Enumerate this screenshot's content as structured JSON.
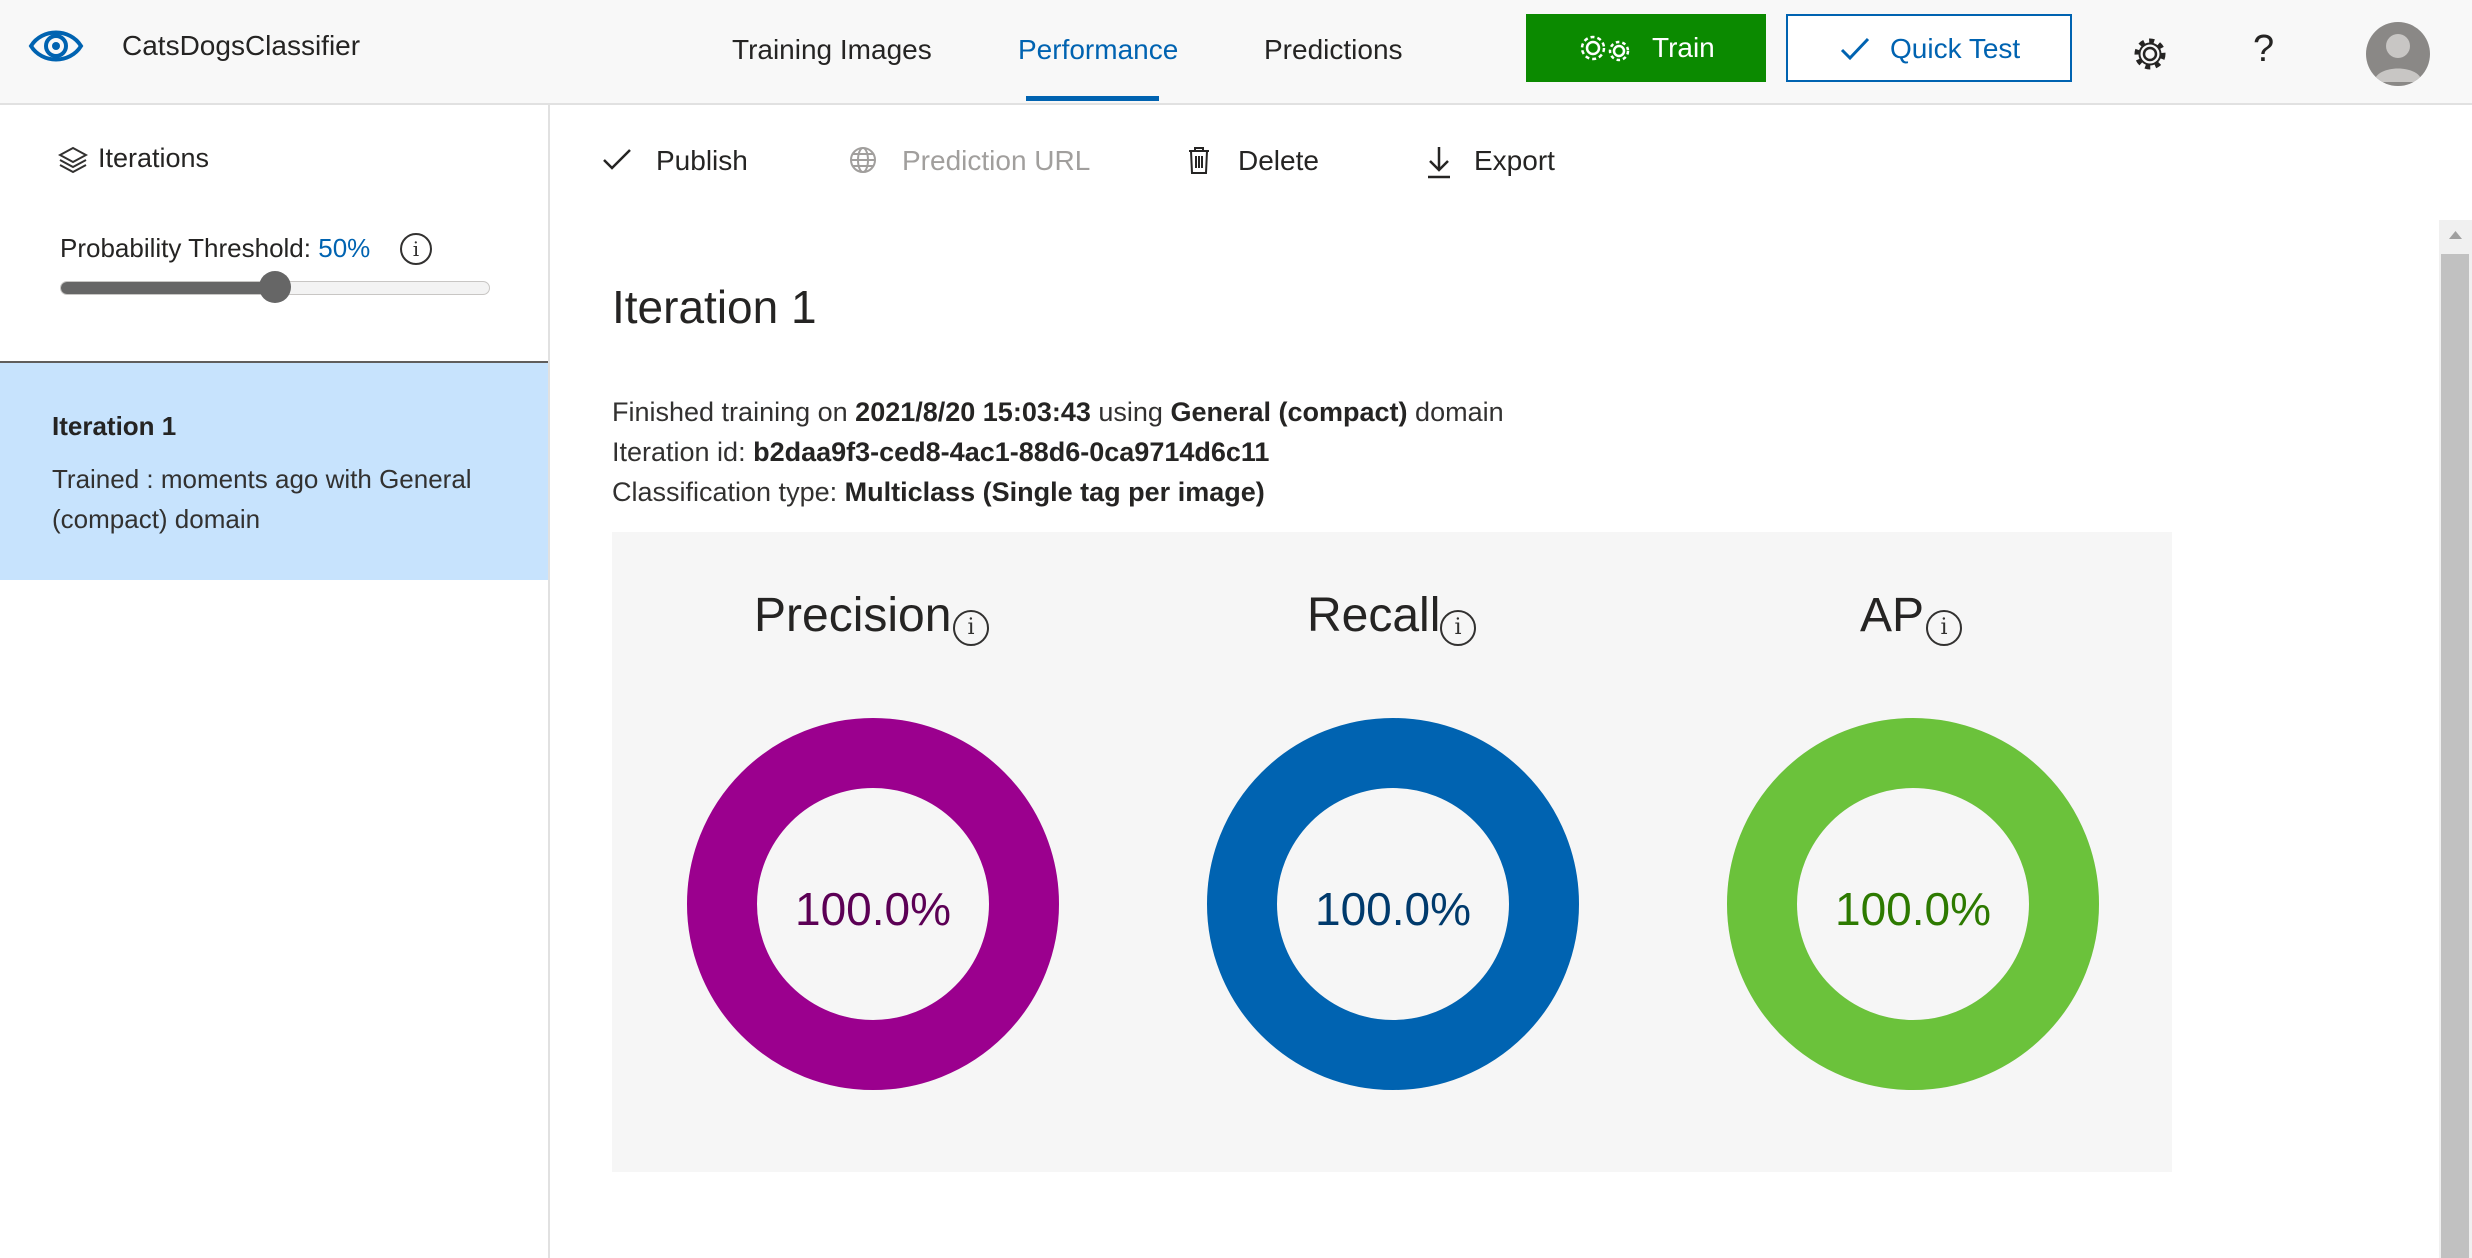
{
  "header": {
    "app_name": "CatsDogsClassifier",
    "tabs": [
      {
        "label": "Training Images",
        "active": false
      },
      {
        "label": "Performance",
        "active": true
      },
      {
        "label": "Predictions",
        "active": false
      }
    ],
    "train_label": "Train",
    "quick_test_label": "Quick Test",
    "help_label": "?",
    "icons": [
      "eye-logo-icon",
      "gears-icon",
      "checkmark-icon",
      "gear-icon",
      "help-icon",
      "user-avatar-icon"
    ]
  },
  "sidebar": {
    "iterations_label": "Iterations",
    "threshold_label": "Probability Threshold:",
    "threshold_value": "50%",
    "threshold_fraction": 0.5,
    "info_glyph": "i",
    "iterations": [
      {
        "title": "Iteration 1",
        "description": "Trained : moments ago with General (compact) domain",
        "selected": true
      }
    ]
  },
  "toolbar": {
    "publish": "Publish",
    "prediction_url": "Prediction URL",
    "delete": "Delete",
    "export": "Export"
  },
  "main": {
    "title": "Iteration 1",
    "finished_prefix": "Finished training on",
    "finished_date": "2021/8/20 15:03:43",
    "using_word": "using",
    "domain_name": "General (compact)",
    "domain_suffix": "domain",
    "iteration_id_label": "Iteration id:",
    "iteration_id": "b2daa9f3-ced8-4ac1-88d6-0ca9714d6c11",
    "classification_label": "Classification type:",
    "classification_value": "Multiclass (Single tag per image)"
  },
  "metrics": [
    {
      "name": "Precision",
      "value": "100.0%",
      "fraction": 1.0,
      "color": "#9b008e",
      "text_color": "#5c0055"
    },
    {
      "name": "Recall",
      "value": "100.0%",
      "fraction": 1.0,
      "color": "#0063b1",
      "text_color": "#003a6c"
    },
    {
      "name": "AP",
      "value": "100.0%",
      "fraction": 1.0,
      "color": "#6bc23b",
      "text_color": "#2d7a00"
    }
  ],
  "colors": {
    "accent": "#0063b1",
    "train_button": "#0b8a00",
    "selected_item": "#c7e3fd"
  }
}
